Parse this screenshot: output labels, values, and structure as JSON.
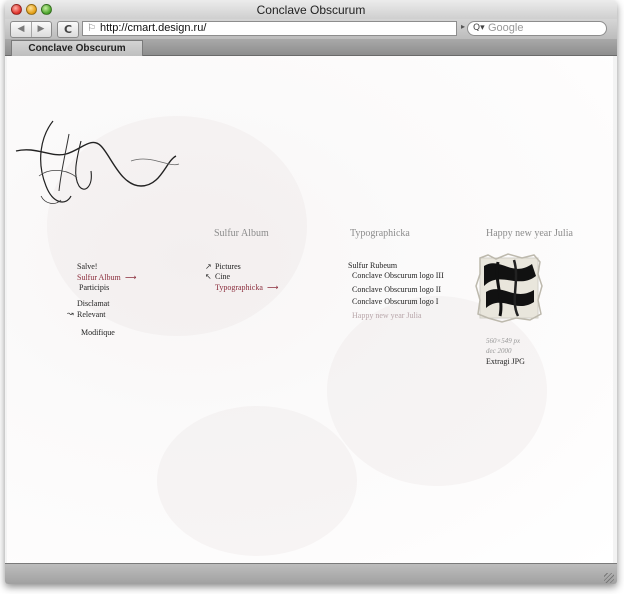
{
  "window": {
    "title": "Conclave Obscurum"
  },
  "toolbar": {
    "back_glyph": "◀",
    "forward_glyph": "▶",
    "reload_glyph": "C",
    "address": "http://cmart.design.ru/",
    "search_placeholder": "Google"
  },
  "tab": {
    "label": "Conclave Obscurum"
  },
  "nav": {
    "items": [
      {
        "label": "Salve!",
        "active": false
      },
      {
        "label": "Sulfur Album",
        "active": true
      },
      {
        "label": "Participis",
        "active": false
      },
      {
        "label": "Disclamat",
        "active": false
      },
      {
        "label": "Relevant",
        "active": false
      },
      {
        "label": "Modifique",
        "active": false
      }
    ]
  },
  "album": {
    "heading": "Sulfur Album",
    "items": [
      {
        "label": "Pictures",
        "active": false
      },
      {
        "label": "Cine",
        "active": false
      },
      {
        "label": "Typographicka",
        "active": true
      }
    ]
  },
  "typographicka": {
    "heading": "Typographicka",
    "items": [
      {
        "label": "Sulfur Rubeum",
        "state": "normal"
      },
      {
        "label": "Conclave Obscurum logo III",
        "state": "normal"
      },
      {
        "label": "Conclave Obscurum logo II",
        "state": "normal"
      },
      {
        "label": "Conclave Obscurum logo I",
        "state": "normal"
      },
      {
        "label": "Happy new year Julia",
        "state": "muted"
      }
    ]
  },
  "detail": {
    "heading": "Happy new year Julia",
    "size": "560×549 px",
    "date": "dec 2000",
    "download": "Extragi JPG"
  },
  "colors": {
    "active_link": "#8b2d3c",
    "muted_link": "#b8a6aa",
    "heading": "#8c8c8c"
  }
}
